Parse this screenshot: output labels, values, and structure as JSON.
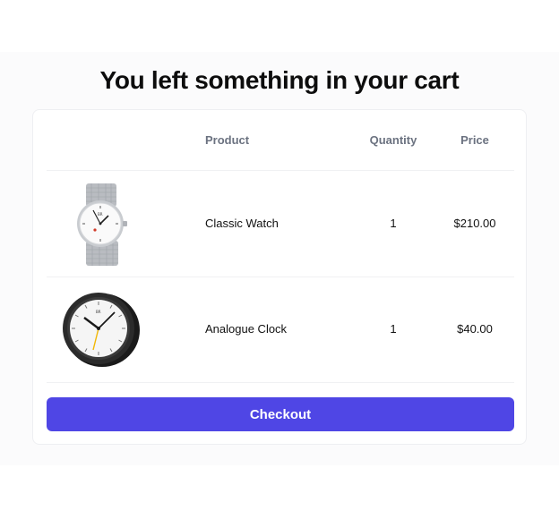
{
  "heading": "You left something in your cart",
  "table": {
    "columns": {
      "product": "Product",
      "quantity": "Quantity",
      "price": "Price"
    },
    "rows": [
      {
        "thumbnail_icon": "wristwatch-image",
        "name": "Classic Watch",
        "quantity": "1",
        "price": "$210.00"
      },
      {
        "thumbnail_icon": "alarm-clock-image",
        "name": "Analogue Clock",
        "quantity": "1",
        "price": "$40.00"
      }
    ]
  },
  "checkout_label": "Checkout",
  "colors": {
    "accent": "#4f46e5",
    "header_text": "#6b7280",
    "page_background": "#fbfbfc"
  }
}
